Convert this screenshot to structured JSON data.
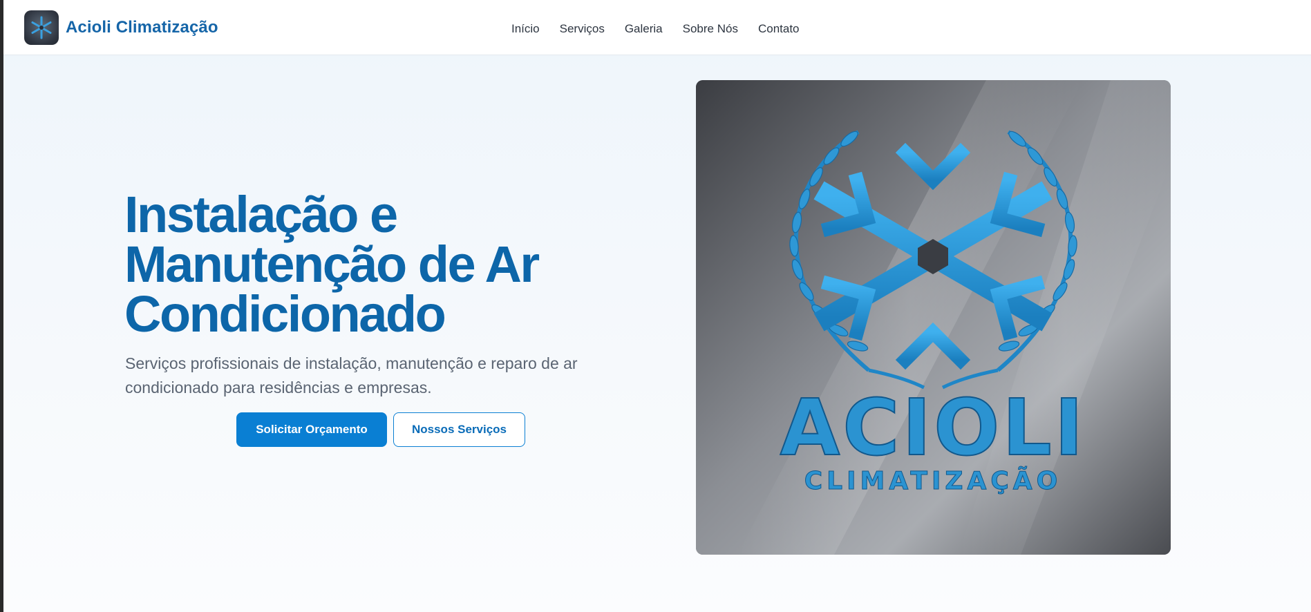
{
  "header": {
    "brand_name": "Acioli Climatização",
    "logo_icon": "acioli-snowflake-logo"
  },
  "nav": {
    "items": [
      {
        "label": "Início"
      },
      {
        "label": "Serviços"
      },
      {
        "label": "Galeria"
      },
      {
        "label": "Sobre Nós"
      },
      {
        "label": "Contato"
      }
    ]
  },
  "hero": {
    "title_lines": [
      "Instalação e",
      "Manutenção de Ar",
      "Condicionado"
    ],
    "subtitle_lines": [
      "Serviços profissionais de instalação, manutenção e reparo de ar",
      "condicionado para residências e empresas."
    ],
    "primary_button": "Solicitar Orçamento",
    "secondary_button": "Nossos Serviços"
  },
  "hero_image": {
    "logo_text": "ACIOLI",
    "logo_subtext": "CLIMATIZAÇÃO"
  },
  "colors": {
    "brand_blue": "#1565a8",
    "title_blue": "#0d66a9",
    "button_blue": "#0a7fd3",
    "logo_blue": "#2d9ad6"
  }
}
